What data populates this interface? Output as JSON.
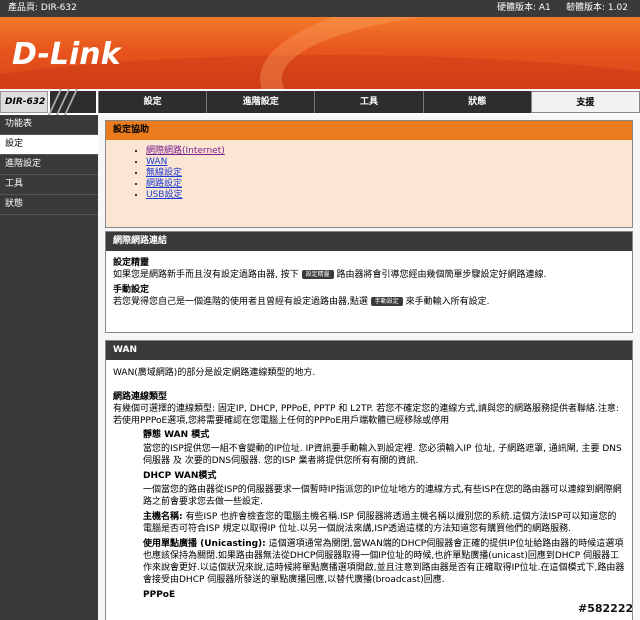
{
  "topbar": {
    "model": "產品頁: DIR-632",
    "hw": "硬體版本: A1",
    "fw": "韌體版本: 1.02"
  },
  "brand": {
    "logo": "D-Link",
    "accent": "#e8551d"
  },
  "nav": {
    "model": "DIR-632",
    "tabs": [
      {
        "label": "設定"
      },
      {
        "label": "進階設定"
      },
      {
        "label": "工具"
      },
      {
        "label": "狀態"
      },
      {
        "label": "支援"
      }
    ]
  },
  "sidebar": {
    "items": [
      {
        "label": "功能表"
      },
      {
        "label": "設定"
      },
      {
        "label": "進階設定"
      },
      {
        "label": "工具"
      },
      {
        "label": "狀態"
      }
    ]
  },
  "help": {
    "title": "設定協助",
    "links": [
      "網際網路(Internet)",
      "WAN",
      "無線設定",
      "網路設定",
      "USB設定"
    ]
  },
  "internet": {
    "title": "網際網路連結",
    "wizard_title": "設定精靈",
    "wizard_text_a": "如果您是網路新手而且沒有設定過路由器, 按下",
    "wizard_btn": "設定精靈",
    "wizard_text_b": "路由器將會引導您經由幾個簡單步驟設定好網路連線.",
    "manual_title": "手動設定",
    "manual_text_a": "若您覺得您自己是一個進階的使用者且曾經有設定過路由器,點選",
    "manual_btn": "手動設定",
    "manual_text_b": "來手動輸入所有設定."
  },
  "wan": {
    "title": "WAN",
    "intro": "WAN(廣域網路)的部分是設定網路連線類型的地方.",
    "type_title": "網路連線類型",
    "type_text": "有幾個可選擇的連線類型: 固定IP, DHCP, PPPoE, PPTP 和 L2TP. 若您不確定您的連線方式,請與您的網路服務提供者聯絡.注意:若使用PPPoE選項,您將需要確認在您電腦上任何的PPPoE用戶端軟體已經移除或停用",
    "static_title": "靜態 WAN 模式",
    "static_text": "當您的ISP提供您一組不會變動的IP位址. IP資訊要手動輸入到設定裡. 您必須輸入IP 位址, 子網路遮罩, 通訊閘, 主要 DNS 伺服器 及 次要的DNS伺服器. 您的ISP 業者將提供您所有有關的資訊.",
    "dhcp_title": "DHCP WAN模式",
    "dhcp_text": "一個當您的路由器從ISP的伺服器要求一個暫時IP指派您的IP位址地方的連線方式,有些ISP在您的路由器可以連線到網際網路之前會要求您去做一些設定.",
    "hostname_label": "主機名稱:",
    "hostname_text": "有些ISP 也許會檢查您的電腦主機名稱.ISP 伺服器將透過主機名稱以識別您的系統.這個方法ISP可以知道您的電腦是否可符合ISP 規定以取得IP 位址.以另一個說法來講,ISP透過這樣的方法知道您有購買他們的網路服務.",
    "unicast_label": "使用單點廣播 (Unicasting):",
    "unicast_text": "這個選項通常為關閉,當WAN端的DHCP伺服器會正確的提供IP位址給路由器的時候這選項也應該保持為關閉.如果路由器無法從DHCP伺服器取得一個IP位址的時候,也許單點廣播(unicast)回應到DHCP 伺服器工作來說會更好.以這個狀況來說,這時候將單點廣播選項開啟,並且注意到路由器是否有正確取得IP位址.在這個模式下,路由器會接受由DHCP 伺服器所發送的單點廣播回應,以替代廣播(broadcast)回應.",
    "pppoe_title": "PPPoE"
  },
  "watermark": "#582222"
}
